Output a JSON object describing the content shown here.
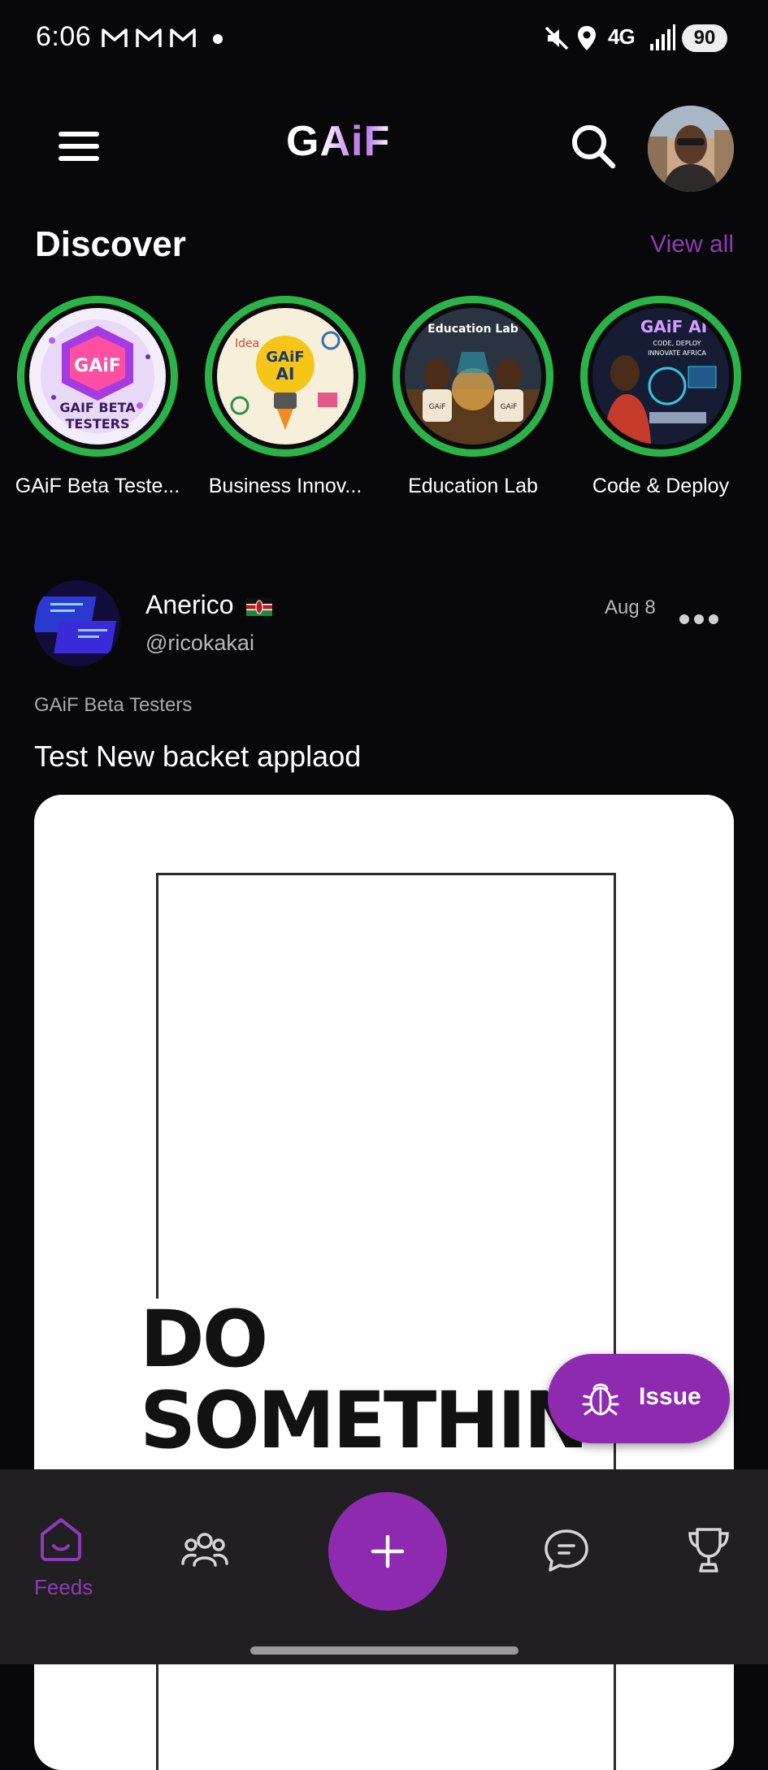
{
  "status_bar": {
    "time": "6:06",
    "network": "4G",
    "battery": "90"
  },
  "header": {
    "logo": "GAiF",
    "avatar_alt": "User avatar"
  },
  "discover": {
    "title": "Discover",
    "view_all": "View all",
    "items": [
      {
        "label": "GAiF Beta Teste...",
        "art_text_1": "GAiF",
        "art_text_2": "GAIF BETA",
        "art_text_3": "TESTERS"
      },
      {
        "label": "Business Innov...",
        "art_text_1": "GAiF",
        "art_text_2": "AI",
        "art_text_3": "Idea"
      },
      {
        "label": "Education Lab",
        "art_text_1": "Education Lab",
        "art_text_2": "GAiF",
        "art_text_3": "GAiF"
      },
      {
        "label": "Code & Deploy",
        "art_text_1": "GAiF AI",
        "art_text_2": "CODE, DEPLOY",
        "art_text_3": "INNOVATE AFRICA"
      }
    ]
  },
  "post": {
    "author": "Anerico",
    "handle": "@ricokakai",
    "date": "Aug 8",
    "group": "GAiF Beta Testers",
    "title": "Test New backet applaod",
    "image_text": "DO\nSOMETHIN\nEPIC"
  },
  "issue_button": {
    "label": "Issue"
  },
  "bottom_nav": {
    "feeds_label": "Feeds"
  },
  "colors": {
    "accent": "#8e2ab0",
    "accent_text": "#8c3bb8",
    "story_ring": "#2bb34a",
    "background": "#08080a",
    "nav_background": "#211f21"
  }
}
